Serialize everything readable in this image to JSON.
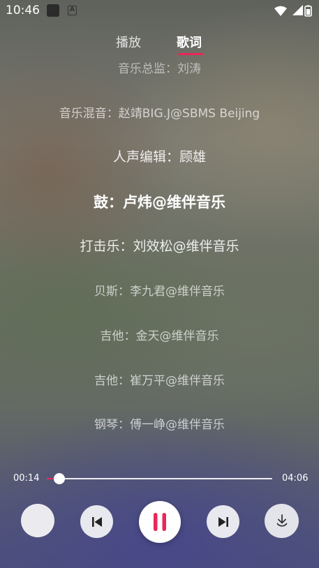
{
  "status_bar": {
    "time": "10:46",
    "notification_letter": "A"
  },
  "tabs": [
    {
      "label": "播放",
      "active": false
    },
    {
      "label": "歌词",
      "active": true
    }
  ],
  "lyrics": {
    "partial_top": "音乐总监：刘涛",
    "lines": [
      {
        "text": "音乐混音：赵靖BIG.J@SBMS Beijing",
        "style": "dim"
      },
      {
        "text": "人声编辑：顾雄",
        "style": "mid"
      },
      {
        "text": "鼓：卢炜@维伴音乐",
        "style": "active"
      },
      {
        "text": "打击乐：刘效松@维伴音乐",
        "style": "mid"
      },
      {
        "text": "贝斯：李九君@维伴音乐",
        "style": "dim"
      },
      {
        "text": "吉他：金天@维伴音乐",
        "style": "dim"
      },
      {
        "text": "吉他：崔万平@维伴音乐",
        "style": "dim"
      },
      {
        "text": "钢琴：傅一峥@维伴音乐",
        "style": "dim"
      }
    ]
  },
  "player": {
    "current_time": "00:14",
    "total_time": "04:06",
    "progress": 0.057
  },
  "colors": {
    "accent": "#e8285a",
    "control_bg": "#f0f0f4"
  },
  "icons": {
    "prev": "skip-previous-icon",
    "pause": "pause-icon",
    "next": "skip-next-icon",
    "download": "download-icon"
  }
}
